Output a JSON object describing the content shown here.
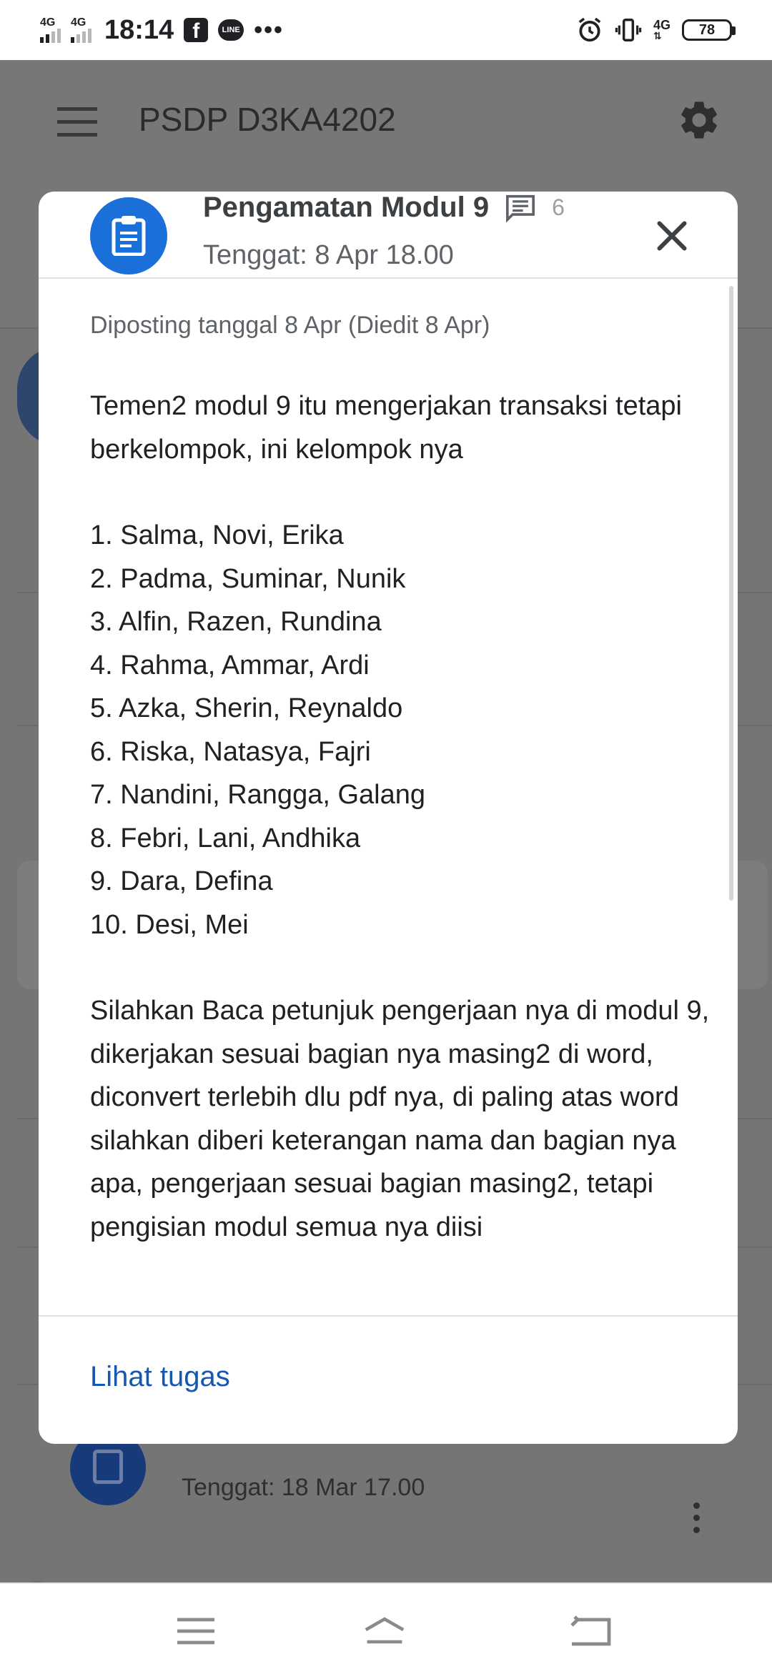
{
  "status_bar": {
    "signal1": "4G",
    "signal2": "4G",
    "time": "18:14",
    "right_net": "4G",
    "battery": "78",
    "icons": [
      "facebook-icon",
      "line-icon",
      "more-dots-icon",
      "alarm-icon",
      "vibrate-icon",
      "battery-icon"
    ]
  },
  "app_bar": {
    "title": "PSDP D3KA4202",
    "menu_icon": "hamburger-icon",
    "settings_icon": "gear-icon"
  },
  "dialog": {
    "title": "Pengamatan Modul 9",
    "comment_count": "6",
    "due": "Tenggat: 8 Apr 18.00",
    "posted": "Diposting tanggal 8 Apr (Diedit 8 Apr)",
    "intro": "Temen2 modul 9 itu mengerjakan transaksi tetapi berkelompok, ini kelompok nya",
    "groups": [
      "1. Salma, Novi, Erika",
      "2. Padma, Suminar, Nunik",
      "3. Alfin, Razen, Rundina",
      "4. Rahma, Ammar, Ardi",
      "5. Azka, Sherin, Reynaldo",
      "6. Riska, Natasya, Fajri",
      "7. Nandini, Rangga, Galang",
      "8. Febri, Lani, Andhika",
      "9. Dara, Defina",
      "10. Desi, Mei"
    ],
    "instructions": "Silahkan Baca petunjuk pengerjaan nya di modul 9, dikerjakan sesuai bagian nya masing2 di word, diconvert terlebih dlu pdf nya, di paling atas word silahkan diberi keterangan nama dan bagian nya apa, pengerjaan sesuai bagian masing2, tetapi pengisian modul semua nya diisi",
    "view_assignment": "Lihat tugas",
    "accent_color": "#1a6fd8"
  },
  "background": {
    "due_item": "Tenggat: 18 Mar 17.00"
  }
}
